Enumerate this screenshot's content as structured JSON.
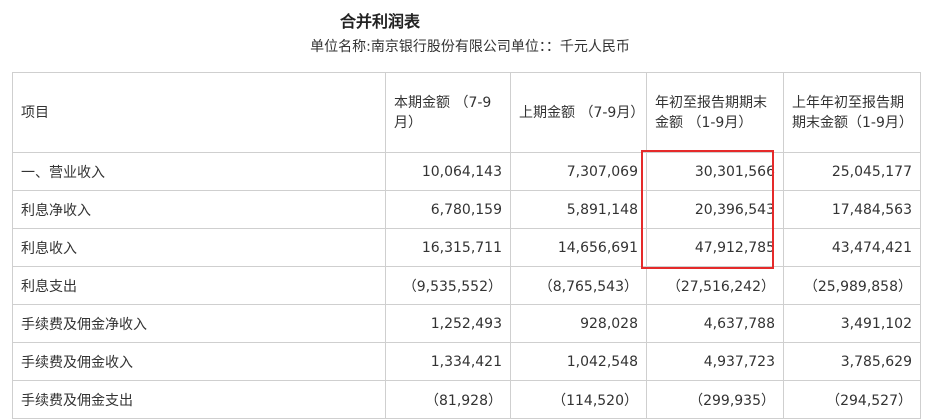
{
  "title": "合并利润表",
  "unit_line": "单位名称:南京银行股份有限公司单位：：千元人民币",
  "table": {
    "headers": [
      "项目",
      "本期金额 （7-9月）",
      "上期金额 （7-9月）",
      "年初至报告期期末金额 （1-9月）",
      "上年年初至报告期期末金额（1-9月）"
    ],
    "rows": [
      [
        "一、营业收入",
        "10,064,143",
        "7,307,069",
        "30,301,566",
        "25,045,177"
      ],
      [
        "利息净收入",
        "6,780,159",
        "5,891,148",
        "20,396,543",
        "17,484,563"
      ],
      [
        "利息收入",
        "16,315,711",
        "14,656,691",
        "47,912,785",
        "43,474,421"
      ],
      [
        "利息支出",
        "（9,535,552）",
        "（8,765,543）",
        "（27,516,242）",
        "（25,989,858）"
      ],
      [
        "手续费及佣金净收入",
        "1,252,493",
        "928,028",
        "4,637,788",
        "3,491,102"
      ],
      [
        "手续费及佣金收入",
        "1,334,421",
        "1,042,548",
        "4,937,723",
        "3,785,629"
      ],
      [
        "手续费及佣金支出",
        "（81,928）",
        "（114,520）",
        "（299,935）",
        "（294,527）"
      ]
    ]
  },
  "highlight_color": "#e52a2a"
}
